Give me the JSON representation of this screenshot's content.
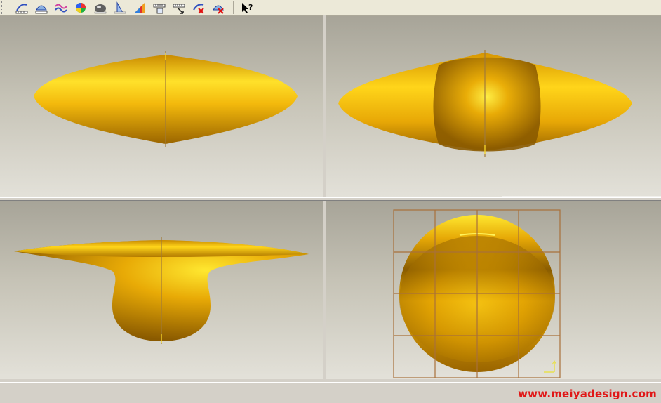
{
  "toolbar": {
    "buttons": [
      {
        "icon": "curve-measure-icon"
      },
      {
        "icon": "surface-measure-icon"
      },
      {
        "icon": "wave-curve-icon"
      },
      {
        "icon": "color-map-icon"
      },
      {
        "icon": "shade-sphere-icon"
      },
      {
        "icon": "section-view-icon"
      },
      {
        "icon": "color-palette-icon"
      },
      {
        "icon": "ruler-grid-icon"
      },
      {
        "icon": "ruler-arrow-icon"
      },
      {
        "icon": "delete-curve-icon"
      },
      {
        "icon": "delete-surface-icon"
      },
      {
        "icon": "context-help-icon"
      }
    ]
  },
  "viewports": [
    {
      "name": "top-view"
    },
    {
      "name": "front-view"
    },
    {
      "name": "side-view"
    },
    {
      "name": "perspective-view"
    }
  ],
  "colors": {
    "gold_light": "#ffe12a",
    "gold_mid": "#e8aa06",
    "gold_dark": "#8a5a00",
    "axis_line": "#a07a3a",
    "grid_line": "#a8703a",
    "watermark": "#e01818"
  },
  "watermark": "www.meiyadesign.com"
}
